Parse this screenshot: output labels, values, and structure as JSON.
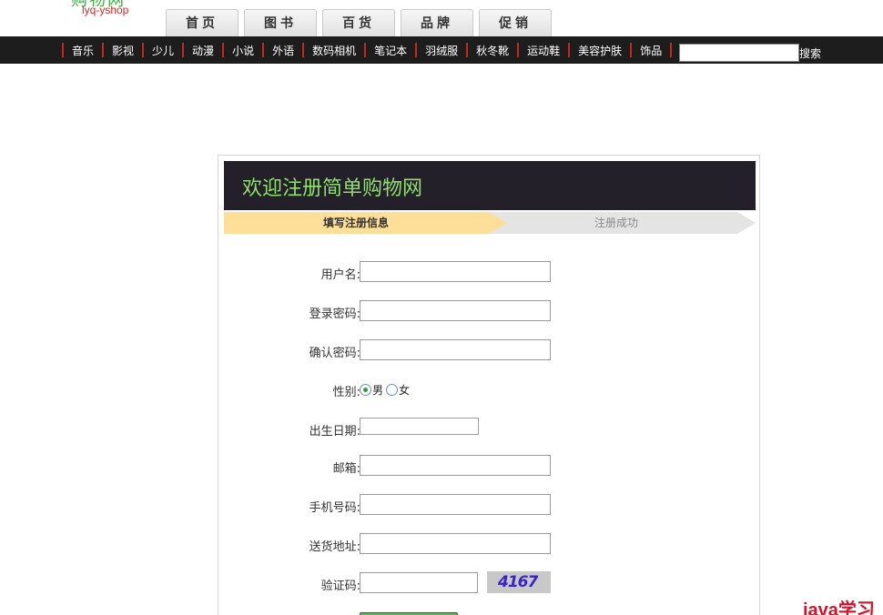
{
  "header": {
    "logo_main": "购物网",
    "logo_sub": "lyq-yshop",
    "tabs": [
      {
        "label": "首页"
      },
      {
        "label": "图书"
      },
      {
        "label": "百货"
      },
      {
        "label": "品牌"
      },
      {
        "label": "促销"
      }
    ]
  },
  "nav": {
    "items": [
      {
        "label": "音乐"
      },
      {
        "label": "影视"
      },
      {
        "label": "少儿"
      },
      {
        "label": "动漫"
      },
      {
        "label": "小说"
      },
      {
        "label": "外语"
      },
      {
        "label": "数码相机"
      },
      {
        "label": "笔记本"
      },
      {
        "label": "羽绒服"
      },
      {
        "label": "秋冬靴"
      },
      {
        "label": "运动鞋"
      },
      {
        "label": "美容护肤"
      },
      {
        "label": "饰品"
      }
    ],
    "search_value": "",
    "search_label": "搜索"
  },
  "register": {
    "title": "欢迎注册简单购物网",
    "steps": [
      {
        "label": "填写注册信息",
        "active": true
      },
      {
        "label": "注册成功",
        "active": false
      }
    ],
    "fields": {
      "username": {
        "label": "用户名:",
        "value": ""
      },
      "password": {
        "label": "登录密码:",
        "value": ""
      },
      "confirm": {
        "label": "确认密码:",
        "value": ""
      },
      "gender": {
        "label": "性别:",
        "options": [
          "男",
          "女"
        ],
        "selected": "男"
      },
      "birthday": {
        "label": "出生日期:",
        "value": ""
      },
      "email": {
        "label": "邮箱:",
        "value": ""
      },
      "phone": {
        "label": "手机号码:",
        "value": ""
      },
      "address": {
        "label": "送货地址:",
        "value": ""
      },
      "captcha": {
        "label": "验证码:",
        "value": "",
        "code": "4167"
      }
    }
  },
  "watermark": "java学习",
  "colors": {
    "nav_bg": "#1d1d1d",
    "nav_separator": "#c3281f",
    "title_bg": "#24202a",
    "title_text": "#8ee06a",
    "step_active": "#fddf9a",
    "step_inactive": "#e4e4e4",
    "captcha_text": "#3a24c8",
    "watermark": "#d4142a"
  }
}
